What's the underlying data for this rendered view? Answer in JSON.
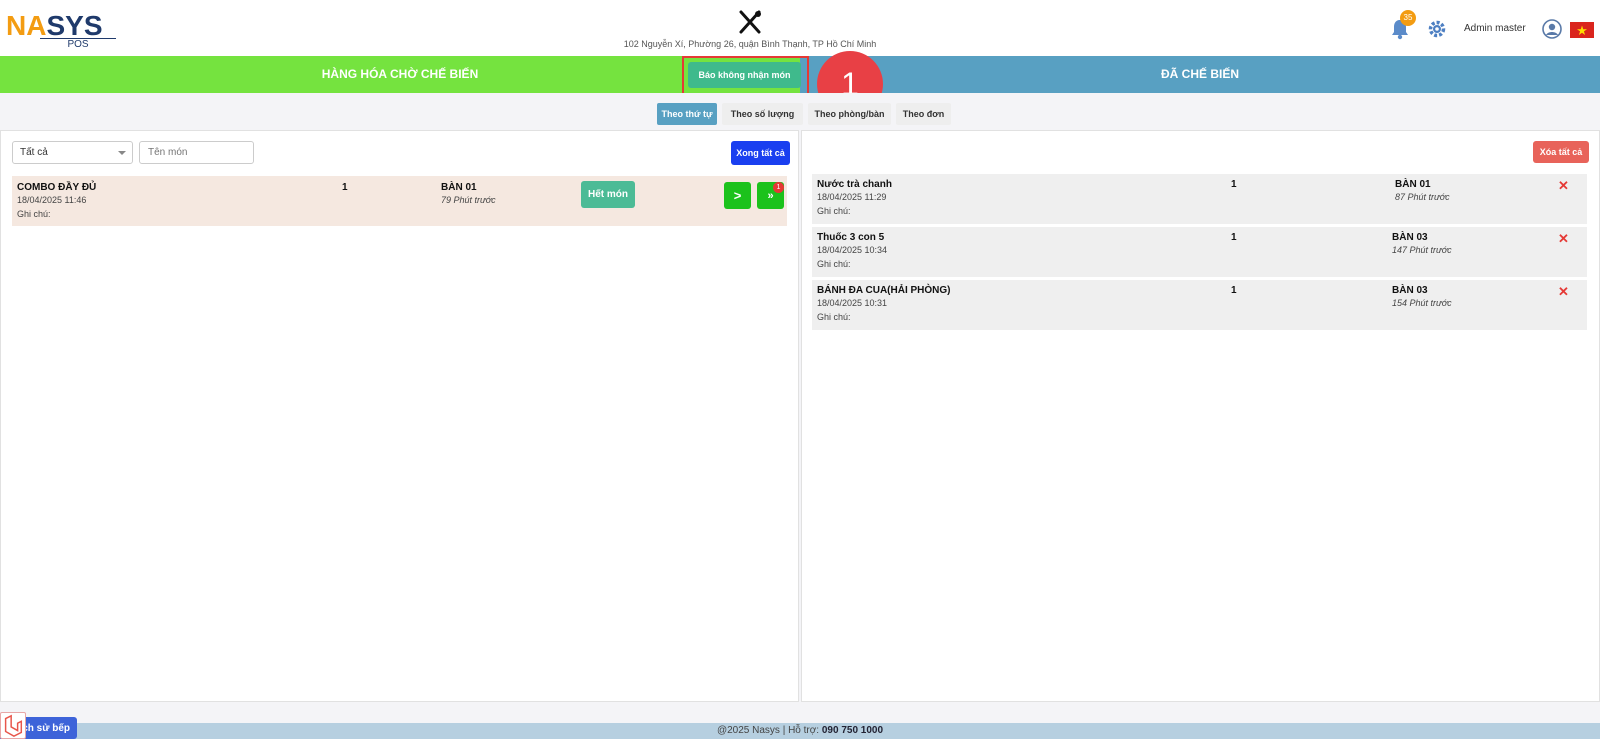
{
  "header": {
    "logo_na": "NA",
    "logo_s": "S",
    "logo_ys": "YS",
    "logo_pos": "POS",
    "address": "102 Nguyễn Xí, Phường 26, quận Bình Thạnh, TP Hồ Chí Minh",
    "notification_count": "35",
    "admin_name": "Admin master"
  },
  "status_bar": {
    "waiting_label": "HÀNG HÓA CHỜ CHẾ BIẾN",
    "done_label": "ĐÃ CHẾ BIẾN",
    "reject_label": "Báo không nhận món",
    "step_marker": "1"
  },
  "view_tabs": [
    {
      "label": "Theo thứ tự",
      "active": true
    },
    {
      "label": "Theo số lượng",
      "active": false
    },
    {
      "label": "Theo phòng/bàn",
      "active": false
    },
    {
      "label": "Theo đơn",
      "active": false
    }
  ],
  "left": {
    "filter_value": "Tất cả",
    "search_placeholder": "Tên món",
    "done_all_label": "Xong tất cả",
    "items": [
      {
        "name": "COMBO ĐẦY ĐỦ",
        "time": "18/04/2025 11:46",
        "note": "Ghi chú:",
        "qty": "1",
        "table": "BÀN 01",
        "ago": "79 Phút trước",
        "out_label": "Hết món",
        "next_label": ">",
        "next_all_label": "»",
        "badge": "1"
      }
    ]
  },
  "right": {
    "clear_all_label": "Xóa tất cả",
    "items": [
      {
        "name": "Nước trà chanh",
        "time": "18/04/2025 11:29",
        "note": "Ghi chú:",
        "qty": "1",
        "table": "BÀN 01",
        "ago": "87 Phút trước"
      },
      {
        "name": "Thuốc 3 con 5",
        "time": "18/04/2025 10:34",
        "note": "Ghi chú:",
        "qty": "1",
        "table": "BÀN 03",
        "ago": "147 Phút trước"
      },
      {
        "name": "BÁNH ĐA CUA(HẢI PHÒNG)",
        "time": "18/04/2025 10:31",
        "note": "Ghi chú:",
        "qty": "1",
        "table": "BÀN 03",
        "ago": "154 Phút trước"
      }
    ],
    "remove_symbol": "✕"
  },
  "footer": {
    "history_label": "ch sử bếp",
    "copyright": "@2025 Nasys | Hỗ trợ: ",
    "hotline": "090 750 1000"
  },
  "colors": {
    "waiting": "#75e33f",
    "done": "#58a0c2",
    "reject_button": "#3fba8c",
    "done_all": "#1a3ff0",
    "clear_all": "#e8635a",
    "marker": "#e84045"
  }
}
